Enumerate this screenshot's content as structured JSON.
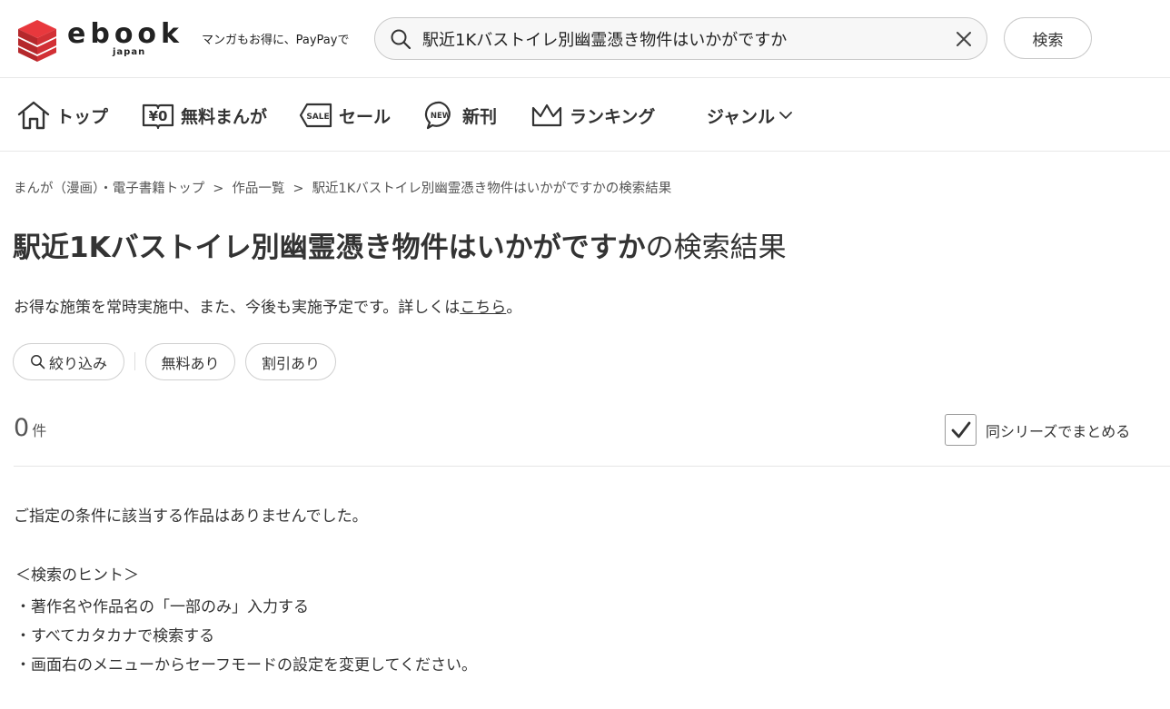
{
  "header": {
    "logo_text": "ebook",
    "logo_sub": "japan",
    "tagline": "マンガもお得に、PayPayで",
    "search": {
      "value": "駅近1Kバストイレ別幽霊憑き物件はいかがですか",
      "placeholder": ""
    },
    "search_button": "検索",
    "colors": {
      "logo_red": "#e8383d",
      "text": "#333333"
    }
  },
  "nav": {
    "items": [
      {
        "label": "トップ",
        "icon": "home-icon"
      },
      {
        "label": "無料まんが",
        "icon": "yen-book-icon"
      },
      {
        "label": "セール",
        "icon": "sale-tag-icon"
      },
      {
        "label": "新刊",
        "icon": "new-badge-icon"
      },
      {
        "label": "ランキング",
        "icon": "crown-icon"
      },
      {
        "label": "ジャンル",
        "icon": "chevron-down-icon"
      }
    ]
  },
  "breadcrumb": [
    "まんが（漫画）・電子書籍トップ",
    "作品一覧",
    "駅近1Kバストイレ別幽霊憑き物件はいかがですかの検索結果"
  ],
  "breadcrumb_sep": ">",
  "title": {
    "keyword": "駅近1Kバストイレ別幽霊憑き物件はいかがですか",
    "suffix": "の検索結果"
  },
  "notice": {
    "text": "お得な施策を常時実施中、また、今後も実施予定です。詳しくは",
    "link": "こちら",
    "end": "。"
  },
  "filters": {
    "refine": "絞り込み",
    "free": "無料あり",
    "discount": "割引あり"
  },
  "results": {
    "count": "0",
    "unit": "件",
    "series_label": "同シリーズでまとめる",
    "series_checked": true
  },
  "empty": {
    "message": "ご指定の条件に該当する作品はありませんでした。",
    "hint_title": "＜検索のヒント＞",
    "hints": [
      "・著作名や作品名の「一部のみ」入力する",
      "・すべてカタカナで検索する",
      "・画面右のメニューからセーフモードの設定を変更してください。"
    ]
  }
}
